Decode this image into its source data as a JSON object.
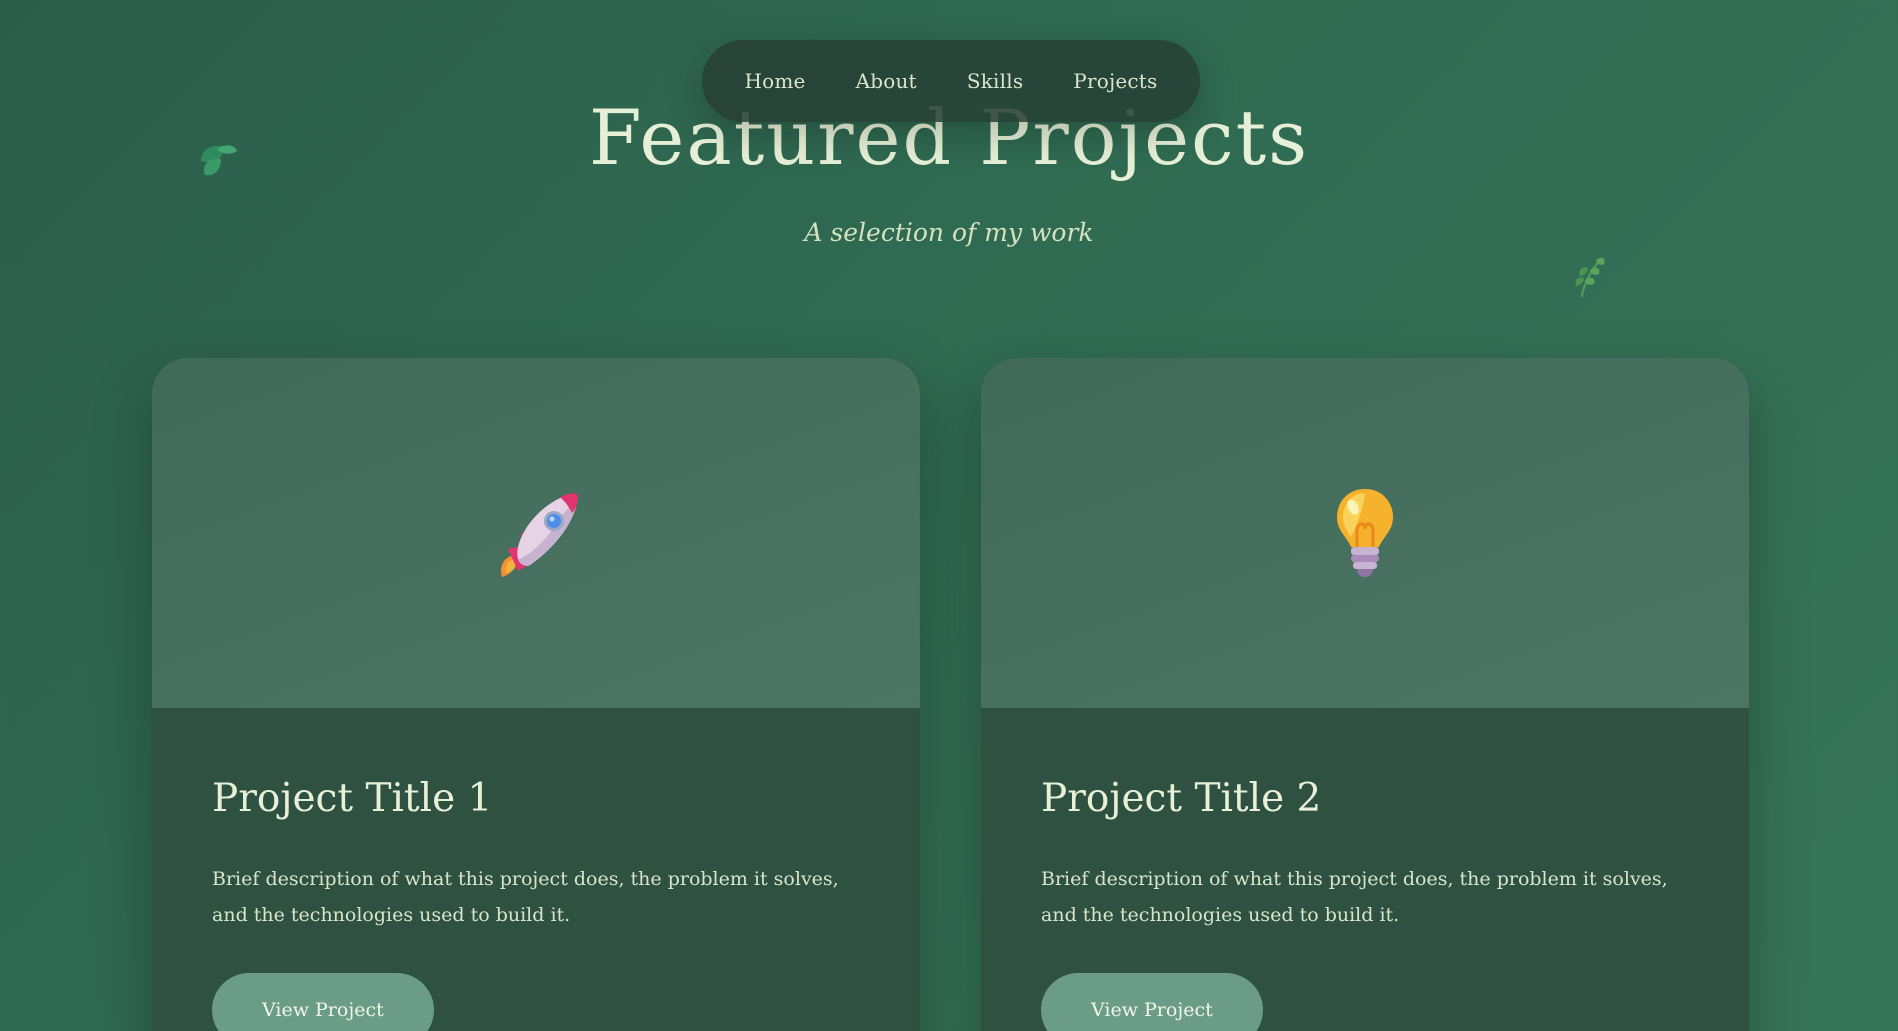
{
  "nav": {
    "items": [
      {
        "label": "Home"
      },
      {
        "label": "About"
      },
      {
        "label": "Skills"
      },
      {
        "label": "Projects"
      }
    ]
  },
  "header": {
    "title": "Featured Projects",
    "subtitle": "A selection of my work"
  },
  "decorations": {
    "left_icon": "leaf-icon",
    "right_icon": "herb-icon"
  },
  "projects": [
    {
      "icon": "rocket-icon",
      "title": "Project Title 1",
      "description": "Brief description of what this project does, the problem it solves, and the technologies used to build it.",
      "button_label": "View Project"
    },
    {
      "icon": "lightbulb-icon",
      "title": "Project Title 2",
      "description": "Brief description of what this project does, the problem it solves, and the technologies used to build it.",
      "button_label": "View Project"
    }
  ],
  "colors": {
    "background": "#2f6a52",
    "nav_background": "#284036",
    "card_media": "#4c7563",
    "card_body": "#2e5142",
    "button": "#6a9c87",
    "text": "#e6f0d6"
  }
}
